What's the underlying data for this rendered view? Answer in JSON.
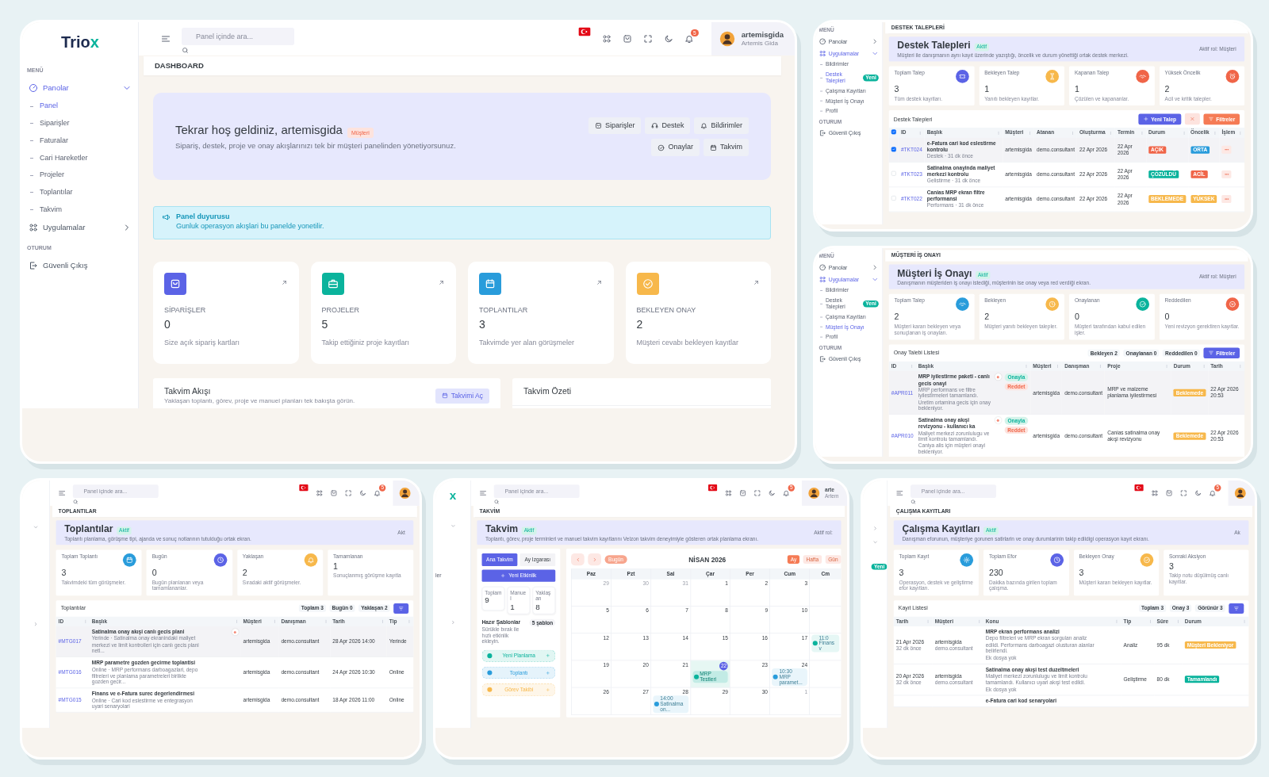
{
  "screens": [
    {
      "kind": "dashboard",
      "logo": {
        "text": "Trio",
        "accent": "x"
      },
      "sidebar": {
        "sections": [
          {
            "title": "MENÜ",
            "items": [
              {
                "label": "Panolar",
                "selected": true,
                "expanded": true,
                "children": [
                  {
                    "label": "Panel",
                    "selected": true
                  },
                  {
                    "label": "Siparişler",
                    "selected": false
                  },
                  {
                    "label": "Faturalar",
                    "selected": false
                  },
                  {
                    "label": "Cari Hareketler",
                    "selected": false
                  },
                  {
                    "label": "Projeler",
                    "selected": false
                  },
                  {
                    "label": "Toplantılar",
                    "selected": false
                  },
                  {
                    "label": "Takvim",
                    "selected": false
                  }
                ]
              },
              {
                "label": "Uygulamalar",
                "selected": false,
                "expanded": false
              }
            ]
          },
          {
            "title": "OTURUM",
            "items": [
              {
                "label": "Güvenli Çıkış",
                "selected": false
              }
            ]
          }
        ]
      },
      "topbar": {
        "search": {
          "placeholder": "Panel içinde ara..."
        },
        "notifications": "5",
        "user": {
          "name": "artemisgida",
          "org": "Artemis Gida"
        }
      },
      "page_title": "DASHBOARD",
      "hero": {
        "title": "Tekrar hoş geldiniz, artemisgida",
        "badge": "Müşteri",
        "subtitle": "Sipariş, destek, proje ve onay akışlarınızı tek bir müşteri panelinden yönetiyorsunuz.",
        "buttons": [
          "Siparişler",
          "Destek",
          "Bildirimler",
          "Onaylar",
          "Takvim"
        ]
      },
      "alert": {
        "title": "Panel duyurusu",
        "text": "Gunluk operasyon akışlari bu panelde yonetilir."
      },
      "stats": [
        {
          "label": "SİPARİŞLER",
          "value": "0",
          "desc": "Size açık sipariş kartları",
          "color": "#5b63e6"
        },
        {
          "label": "PROJELER",
          "value": "5",
          "desc": "Takip ettiğiniz proje kayıtları",
          "color": "#0ab39c"
        },
        {
          "label": "TOPLANTILAR",
          "value": "3",
          "desc": "Takvimde yer alan görüşmeler",
          "color": "#299cdb"
        },
        {
          "label": "BEKLEYEN ONAY",
          "value": "2",
          "desc": "Müşteri cevabı bekleyen kayıtlar",
          "color": "#f7b84b"
        }
      ],
      "panels": [
        {
          "title": "Takvim Akışı",
          "subtitle": "Yaklaşan toplantı, görev, proje ve manuel planları tek bakışta görün.",
          "button": "Takvimi Aç"
        },
        {
          "title": "Takvim Özeti"
        }
      ]
    },
    {
      "kind": "list",
      "sidebar": {
        "sections": [
          {
            "title": "MENÜ",
            "items": [
              {
                "label": "Panolar",
                "selected": false,
                "expanded": false
              },
              {
                "label": "Uygulamalar",
                "selected": true,
                "expanded": true,
                "children": [
                  {
                    "label": "Bildirimler",
                    "selected": false
                  },
                  {
                    "label": "Destek Talepleri",
                    "selected": true,
                    "badge": "Yeni"
                  },
                  {
                    "label": "Çalışma Kayıtları",
                    "selected": false
                  },
                  {
                    "label": "Müşteri İş Onayı",
                    "selected": false
                  },
                  {
                    "label": "Profil",
                    "selected": false
                  }
                ]
              }
            ]
          },
          {
            "title": "OTURUM",
            "items": [
              {
                "label": "Güvenli Çıkış",
                "selected": false
              }
            ]
          }
        ]
      },
      "page_title": "DESTEK TALEPLERİ",
      "hero": {
        "title": "Destek Talepleri",
        "badge": "Aktif",
        "subtitle": "Müşteri ile danışmanın aynı kayıt üzerinde yazıştığı, öncelik ve durum yönettiği ortak destek merkezi.",
        "role": "Aktif rol: Müşteri"
      },
      "stats": [
        {
          "label": "Toplam Talep",
          "value": "3",
          "desc": "Tüm destek kayıtları.",
          "color": "#5b63e6"
        },
        {
          "label": "Bekleyen Talep",
          "value": "1",
          "desc": "Yanıtı bekleyen kayıtlar.",
          "color": "#f7b84b"
        },
        {
          "label": "Kapanan Talep",
          "value": "1",
          "desc": "Çözülen ve kapananlar.",
          "color": "#f06548"
        },
        {
          "label": "Yüksek Öncelik",
          "value": "2",
          "desc": "Acil ve kritik talepler.",
          "color": "#f06548"
        }
      ],
      "table": {
        "title": "Destek Talepleri",
        "buttons": [
          {
            "kind": "primary",
            "label": "Yeni Talep"
          },
          {
            "kind": "close"
          },
          {
            "kind": "filter",
            "label": "Filtreler"
          }
        ],
        "columns": [
          {
            "kind": "check",
            "checked": true
          },
          {
            "kind": "text",
            "label": "ID"
          },
          {
            "kind": "text",
            "label": "Başlık"
          },
          {
            "kind": "text",
            "label": "Müşteri"
          },
          {
            "kind": "text",
            "label": "Atanan"
          },
          {
            "kind": "text",
            "label": "Oluşturma"
          },
          {
            "kind": "text",
            "label": "Termin"
          },
          {
            "kind": "text",
            "label": "Durum"
          },
          {
            "kind": "text",
            "label": "Öncelik"
          },
          {
            "kind": "text",
            "label": "İşlem"
          }
        ],
        "rows": [
          {
            "selected": true,
            "cells": [
              {
                "kind": "check",
                "checked": true
              },
              {
                "kind": "link",
                "text": "#TKT024"
              },
              {
                "kind": "title",
                "text": "e-Fatura cari kod eslestirme kontrolu",
                "sub": "Destek · 31 dk önce"
              },
              {
                "kind": "text",
                "text": "artemisgida"
              },
              {
                "kind": "text",
                "text": "demo.consultant"
              },
              {
                "kind": "text",
                "text": "22 Apr 2026"
              },
              {
                "kind": "text",
                "text": "22 Apr 2026"
              },
              {
                "kind": "badge",
                "text": "AÇIK",
                "color": "#f06548"
              },
              {
                "kind": "tag",
                "text": "ORTA",
                "color": "#299cdb"
              },
              {
                "kind": "menu"
              }
            ]
          },
          {
            "selected": false,
            "cells": [
              {
                "kind": "check",
                "checked": false
              },
              {
                "kind": "link",
                "text": "#TKT023"
              },
              {
                "kind": "title",
                "text": "Satinalma onayinda maliyet merkezi kontrolu",
                "sub": "Gelistirme · 31 dk önce"
              },
              {
                "kind": "text",
                "text": "artemisgida"
              },
              {
                "kind": "text",
                "text": "demo.consultant"
              },
              {
                "kind": "text",
                "text": "22 Apr 2026"
              },
              {
                "kind": "text",
                "text": "22 Apr 2026"
              },
              {
                "kind": "badge",
                "text": "ÇÖZÜLDÜ",
                "color": "#0ab39c"
              },
              {
                "kind": "tag",
                "text": "ACİL",
                "color": "#f06548"
              },
              {
                "kind": "menu"
              }
            ]
          },
          {
            "selected": false,
            "cells": [
              {
                "kind": "check",
                "checked": false
              },
              {
                "kind": "link",
                "text": "#TKT022"
              },
              {
                "kind": "title",
                "text": "Canias MRP ekran filtre performansi",
                "sub": "Performans · 31 dk önce"
              },
              {
                "kind": "text",
                "text": "artemisgida"
              },
              {
                "kind": "text",
                "text": "demo.consultant"
              },
              {
                "kind": "text",
                "text": "22 Apr 2026"
              },
              {
                "kind": "text",
                "text": "22 Apr 2026"
              },
              {
                "kind": "badge",
                "text": "BEKLEMEDE",
                "color": "#f7b84b"
              },
              {
                "kind": "tag",
                "text": "YÜKSEK",
                "color": "#f7b84b"
              },
              {
                "kind": "menu"
              }
            ]
          }
        ]
      }
    },
    {
      "kind": "list",
      "sidebar": {
        "sections": [
          {
            "title": "MENÜ",
            "items": [
              {
                "label": "Panolar",
                "selected": false,
                "expanded": false
              },
              {
                "label": "Uygulamalar",
                "selected": true,
                "expanded": true,
                "children": [
                  {
                    "label": "Bildirimler",
                    "selected": false
                  },
                  {
                    "label": "Destek Talepleri",
                    "selected": false,
                    "badge": "Yeni"
                  },
                  {
                    "label": "Çalışma Kayıtları",
                    "selected": false
                  },
                  {
                    "label": "Müşteri İş Onayı",
                    "selected": true
                  },
                  {
                    "label": "Profil",
                    "selected": false
                  }
                ]
              }
            ]
          },
          {
            "title": "OTURUM",
            "items": [
              {
                "label": "Güvenli Çıkış",
                "selected": false
              }
            ]
          }
        ]
      },
      "page_title": "MÜŞTERİ İŞ ONAYI",
      "hero": {
        "title": "Müşteri İş Onayı",
        "badge": "Aktif",
        "subtitle": "Danışmanın müşteriden iş onayı istediği, müşterinin ise onay veya red verdiği ekran.",
        "role": "Aktif rol: Müşteri"
      },
      "stats": [
        {
          "label": "Toplam Talep",
          "value": "2",
          "desc": "Müşteri kararı bekleyen veya sonuçlanan iş onayları.",
          "color": "#299cdb"
        },
        {
          "label": "Bekleyen",
          "value": "2",
          "desc": "Müşteri yanıtı bekleyen talepler.",
          "color": "#f7b84b"
        },
        {
          "label": "Onaylanan",
          "value": "0",
          "desc": "Müşteri tarafından kabul edilen işler.",
          "color": "#0ab39c"
        },
        {
          "label": "Reddedilen",
          "value": "0",
          "desc": "Yeni revizyon gerektiren kayıtlar.",
          "color": "#f06548"
        }
      ],
      "table": {
        "title": "Onay Talebi Listesi",
        "chips": [
          "Bekleyen 2",
          "Onaylanan 0",
          "Reddedilen 0"
        ],
        "buttons": [
          {
            "kind": "filter",
            "label": "Filtreler"
          }
        ],
        "columns": [
          {
            "kind": "text",
            "label": "ID"
          },
          {
            "kind": "text",
            "label": "Başlık"
          },
          {
            "kind": "text",
            "label": "Müşteri"
          },
          {
            "kind": "text",
            "label": "Danışman"
          },
          {
            "kind": "text",
            "label": "Proje"
          },
          {
            "kind": "text",
            "label": "Durum"
          },
          {
            "kind": "text",
            "label": "Tarih"
          }
        ],
        "rows": [
          {
            "selected": true,
            "cells": [
              {
                "kind": "link",
                "text": "#APR011"
              },
              {
                "kind": "title",
                "text": "MRP iyilestirme paketi - canlı gecis onayi",
                "sub": "MRP performans ve filtre iyilestirmeleri tamamlandı. Uretim ortamina gecis için onay bekleniyor.",
                "marker": true,
                "actions": [
                  "Onayla",
                  "Reddet"
                ]
              },
              {
                "kind": "text",
                "text": "artemisgida"
              },
              {
                "kind": "text",
                "text": "demo.consultant"
              },
              {
                "kind": "text",
                "text": "MRP ve malzeme planlama iyilestirmesi"
              },
              {
                "kind": "badge",
                "text": "Beklemede",
                "color": "#f7b84b"
              },
              {
                "kind": "text",
                "text": "22 Apr 2026 20:53"
              }
            ]
          },
          {
            "selected": false,
            "cells": [
              {
                "kind": "link",
                "text": "#APR010"
              },
              {
                "kind": "title",
                "text": "Satinalma onay akışi revizyonu - kullanıcı ka",
                "sub": "Maliyet merkezi zorunlulugu ve limit kontrolu tamamlandı. Caniya alis için müşteri onayi bekleniyor.",
                "marker": true,
                "actions": [
                  "Onayla",
                  "Reddet"
                ]
              },
              {
                "kind": "text",
                "text": "artemisgida"
              },
              {
                "kind": "text",
                "text": "demo.consultant"
              },
              {
                "kind": "text",
                "text": "Canias satinalma onay akışi revizyonu"
              },
              {
                "kind": "badge",
                "text": "Beklemede",
                "color": "#f7b84b"
              },
              {
                "kind": "text",
                "text": "22 Apr 2026 20:53"
              }
            ]
          }
        ]
      }
    },
    {
      "kind": "list",
      "sidebar_stub": {
        "items": [
          {
            "kind": "chevron-down"
          },
          {
            "kind": "chevron-right"
          }
        ]
      },
      "topbar": {
        "search": {
          "placeholder": "Panel içinde ara..."
        },
        "notifications": "5"
      },
      "page_title": "TOPLANTILAR",
      "hero": {
        "title": "Toplantılar",
        "badge": "Aktif",
        "subtitle": "Toplantı planlama, görüşme tipi, ajanda ve sonuç notlarının tutulduğu ortak ekran.",
        "role": "Akt"
      },
      "stats": [
        {
          "label": "Toplam Toplantı",
          "value": "3",
          "desc": "Takvimdeki tüm görüşmeler.",
          "color": "#299cdb"
        },
        {
          "label": "Bugün",
          "value": "0",
          "desc": "Bugün planlanan veya tamamlananlar.",
          "color": "#5b63e6"
        },
        {
          "label": "Yaklaşan",
          "value": "2",
          "desc": "Sıradaki aktif görüşmeler.",
          "color": "#f7b84b"
        },
        {
          "label": "Tamamlanan",
          "value": "1",
          "desc": "Sonuçlanmış görüşme kayıtla"
        }
      ],
      "table": {
        "title": "Toplantılar",
        "chips": [
          "Toplam 3",
          "Bugün 0",
          "Yaklaşan 2"
        ],
        "buttons": [
          {
            "kind": "filter"
          }
        ],
        "columns": [
          {
            "kind": "text",
            "label": "ID"
          },
          {
            "kind": "text",
            "label": "Başlık"
          },
          {
            "kind": "text",
            "label": "Müşteri"
          },
          {
            "kind": "text",
            "label": "Danışman"
          },
          {
            "kind": "text",
            "label": "Tarih"
          },
          {
            "kind": "text",
            "label": "Tip"
          }
        ],
        "rows": [
          {
            "selected": true,
            "cells": [
              {
                "kind": "link",
                "text": "#MTG017"
              },
              {
                "kind": "title",
                "text": "Satinalma onay akışi canlı gecis plani",
                "sub": "Yerinde · Satinalma onay ekranindaki maliyet merkezi ve limit kontrolleri için canlı gecis plani netl...",
                "marker": true
              },
              {
                "kind": "text",
                "text": "artemisgida"
              },
              {
                "kind": "text",
                "text": "demo.consultant"
              },
              {
                "kind": "text",
                "text": "28 Apr 2026 14:00"
              },
              {
                "kind": "text",
                "text": "Yerinde"
              }
            ]
          },
          {
            "selected": false,
            "cells": [
              {
                "kind": "link",
                "text": "#MTG016"
              },
              {
                "kind": "title",
                "text": "MRP parametre gozden gecirme toplantisi",
                "sub": "Online · MRP performans darboagazlari, depo filtreleri ve planlama parametreleri birlikte gozden gecir...",
                "marker": false
              },
              {
                "kind": "text",
                "text": "artemisgida"
              },
              {
                "kind": "text",
                "text": "demo.consultant"
              },
              {
                "kind": "text",
                "text": "24 Apr 2026 10:30"
              },
              {
                "kind": "text",
                "text": "Online"
              }
            ]
          },
          {
            "selected": false,
            "cells": [
              {
                "kind": "link",
                "text": "#MTG015"
              },
              {
                "kind": "title",
                "text": "Finans ve e-Fatura surec degerlendirmesi",
                "sub": "Online · Cari kod eslestirme ve entegrasyon uyari senaryolari",
                "marker": false
              },
              {
                "kind": "text",
                "text": "artemisgida"
              },
              {
                "kind": "text",
                "text": "demo.consultant"
              },
              {
                "kind": "text",
                "text": "18 Apr 2026 11:00"
              },
              {
                "kind": "text",
                "text": "Online"
              }
            ]
          }
        ]
      }
    },
    {
      "kind": "calendar",
      "logo": {
        "accent": "x"
      },
      "sidebar_stub": {
        "items": [
          {
            "kind": "chevron-down"
          },
          {
            "kind": "text",
            "text": "ler"
          },
          {
            "kind": "chevron-right"
          }
        ]
      },
      "topbar": {
        "search": {
          "placeholder": "Panel içinde ara..."
        },
        "notifications": "5",
        "user": {
          "name": "arte",
          "org": "Artem"
        }
      },
      "page_title": "TAKVİM",
      "hero": {
        "title": "Takvim",
        "badge": "Aktif",
        "subtitle": "Toplantı, görev, proje terminleri ve manuel takvim kayıtlarını Velzon takvim deneyimiyle gösteren ortak planlama ekranı.",
        "role": "Aktif rol:"
      },
      "planner": {
        "tabs": [
          {
            "label": "Ana Takvim",
            "selected": true
          },
          {
            "label": "Ay Izgarası",
            "selected": false
          }
        ],
        "new_button": "Yeni Etkinlik",
        "counts": [
          {
            "label": "Toplam",
            "value": "9"
          },
          {
            "label": "Manuel",
            "value": "1"
          },
          {
            "label": "Yaklaşan",
            "value": "8"
          }
        ],
        "templates_title": "Hazır Şablonlar",
        "templates_count": "5 şablon",
        "templates_desc": "Sürükle bırak ile hızlı etkinlik ekleyin.",
        "templates": [
          {
            "label": "Yeni Planlama",
            "color": "#0ab39c"
          },
          {
            "label": "Toplantı",
            "color": "#299cdb"
          },
          {
            "label": "Görev Takibi",
            "color": "#f7b84b"
          }
        ]
      },
      "calendar": {
        "today_button": "Bugün",
        "title": "NİSAN 2026",
        "views": [
          {
            "label": "Ay",
            "selected": true
          },
          {
            "label": "Hafta",
            "selected": false
          },
          {
            "label": "Gün",
            "selected": false
          }
        ],
        "weekdays": [
          "Paz",
          "Pzt",
          "Sal",
          "Çar",
          "Per",
          "Cum",
          "Cm"
        ],
        "weeks": [
          [
            {
              "day": "29",
              "muted": true,
              "today": false
            },
            {
              "day": "30",
              "muted": true,
              "today": false
            },
            {
              "day": "31",
              "muted": true,
              "today": false
            },
            {
              "day": "1",
              "muted": false,
              "today": false
            },
            {
              "day": "2",
              "muted": false,
              "today": false
            },
            {
              "day": "3",
              "muted": false,
              "today": false
            }
          ],
          [
            {
              "day": "5",
              "muted": false,
              "today": false
            },
            {
              "day": "6",
              "muted": false,
              "today": false
            },
            {
              "day": "7",
              "muted": false,
              "today": false
            },
            {
              "day": "8",
              "muted": false,
              "today": false
            },
            {
              "day": "9",
              "muted": false,
              "today": false
            },
            {
              "day": "10",
              "muted": false,
              "today": false
            }
          ],
          [
            {
              "day": "12",
              "muted": false,
              "today": false
            },
            {
              "day": "13",
              "muted": false,
              "today": false
            },
            {
              "day": "14",
              "muted": false,
              "today": false
            },
            {
              "day": "15",
              "muted": false,
              "today": false
            },
            {
              "day": "16",
              "muted": false,
              "today": false
            },
            {
              "day": "17",
              "muted": false,
              "today": false
            },
            {
              "events": [
                {
                  "time": "11:0",
                  "text": "Finans v",
                  "color": "#0ab39c",
                  "faded": true
                }
              ]
            }
          ],
          [
            {
              "day": "19",
              "muted": false,
              "today": false
            },
            {
              "day": "20",
              "muted": false,
              "today": false
            },
            {
              "day": "21",
              "muted": false,
              "today": false
            },
            {
              "day": "22",
              "muted": false,
              "today": true,
              "events": [
                {
                  "text": "MRP Testleri",
                  "color": "#0ab39c",
                  "faded": false
                }
              ]
            },
            {
              "day": "23",
              "muted": false,
              "today": false
            },
            {
              "day": "24",
              "muted": false,
              "today": false,
              "events": [
                {
                  "time": "10:30",
                  "text": "MRP paramet...",
                  "color": "#299cdb",
                  "faded": true
                }
              ]
            }
          ],
          [
            {
              "day": "26",
              "muted": false,
              "today": false
            },
            {
              "day": "27",
              "muted": false,
              "today": false
            },
            {
              "day": "28",
              "muted": false,
              "today": false,
              "events": [
                {
                  "time": "14:00",
                  "text": "Satinalma on...",
                  "color": "#299cdb",
                  "faded": true
                }
              ]
            },
            {
              "day": "29",
              "muted": false,
              "today": false
            },
            {
              "day": "30",
              "muted": false,
              "today": false
            },
            {
              "day": "1",
              "muted": true,
              "today": false
            }
          ]
        ]
      }
    },
    {
      "kind": "list",
      "sidebar_stub": {
        "items": [
          {
            "kind": "chevron-right"
          },
          {
            "kind": "chevron-down"
          },
          {
            "kind": "badge",
            "text": "Yeni"
          }
        ]
      },
      "topbar": {
        "search": {
          "placeholder": "Panel içinde ara..."
        },
        "notifications": "5"
      },
      "page_title": "ÇALIŞMA KAYITLARI",
      "hero": {
        "title": "Çalışma Kayıtları",
        "badge": "Aktif",
        "subtitle": "Danışman eforunun, müşteriye gorunen satirlarin ve onay durumlarinin takip edildigi operasyon kayıt ekranı.",
        "role": "Ak"
      },
      "stats": [
        {
          "label": "Toplam Kayıt",
          "value": "3",
          "desc": "Operasyon, destek ve geliştirme efor kayıtları.",
          "color": "#299cdb"
        },
        {
          "label": "Toplam Efor",
          "value": "230",
          "desc": "Dakika bazında girilen toplam çalışma.",
          "color": "#5b63e6"
        },
        {
          "label": "Bekleyen Onay",
          "value": "3",
          "desc": "Müşteri kararı bekleyen kayıtlar.",
          "color": "#f7b84b"
        },
        {
          "label": "Sonraki Aksiyon",
          "value": "3",
          "desc": "Takip notu düşülmüş canlı kayıtlar."
        }
      ],
      "table": {
        "title": "Kayıt Listesi",
        "chips": [
          "Toplam 3",
          "Onay 3",
          "Görünür 3"
        ],
        "buttons": [
          {
            "kind": "filter"
          }
        ],
        "columns": [
          {
            "kind": "text",
            "label": "Tarih"
          },
          {
            "kind": "text",
            "label": "Müşteri"
          },
          {
            "kind": "text",
            "label": "Konu"
          },
          {
            "kind": "text",
            "label": "Tip"
          },
          {
            "kind": "text",
            "label": "Süre"
          },
          {
            "kind": "text",
            "label": "Durum"
          }
        ],
        "rows": [
          {
            "selected": false,
            "cells": [
              {
                "kind": "stack",
                "text": "21 Apr 2026",
                "sub": "32 dk önce"
              },
              {
                "kind": "stack",
                "text": "artemisgida",
                "sub": "demo.consultant"
              },
              {
                "kind": "title",
                "text": "MRP ekran performans analizi",
                "sub": "Depo filtreleri ve MRP ekran sorguları analiz edildi. Performans darboagazi olusturan alanlar belirlendi.",
                "note": "Ek dosya yok"
              },
              {
                "kind": "text",
                "text": "Analiz"
              },
              {
                "kind": "text",
                "text": "95 dk"
              },
              {
                "kind": "badge",
                "text": "Müşteri Bekleniyor",
                "color": "#f7b84b"
              }
            ]
          },
          {
            "selected": false,
            "cells": [
              {
                "kind": "stack",
                "text": "20 Apr 2026",
                "sub": "32 dk önce"
              },
              {
                "kind": "stack",
                "text": "artemisgida",
                "sub": "demo.consultant"
              },
              {
                "kind": "title",
                "text": "Satinalma onay akışi test duzeltmeleri",
                "sub": "Maliyet merkezi zorunlulugu ve limit kontrolu tamamlandı. Kullanıcı uyari akışi test edildi.",
                "note": "Ek dosya yok"
              },
              {
                "kind": "text",
                "text": "Geliştirme"
              },
              {
                "kind": "text",
                "text": "80 dk"
              },
              {
                "kind": "badge",
                "text": "Tamamlandı",
                "color": "#0ab39c"
              }
            ]
          },
          {
            "selected": false,
            "cells": [
              {
                "kind": "empty"
              },
              {
                "kind": "empty"
              },
              {
                "kind": "title",
                "text": "e-Fatura cari kod senaryolari"
              }
            ]
          }
        ]
      }
    }
  ]
}
